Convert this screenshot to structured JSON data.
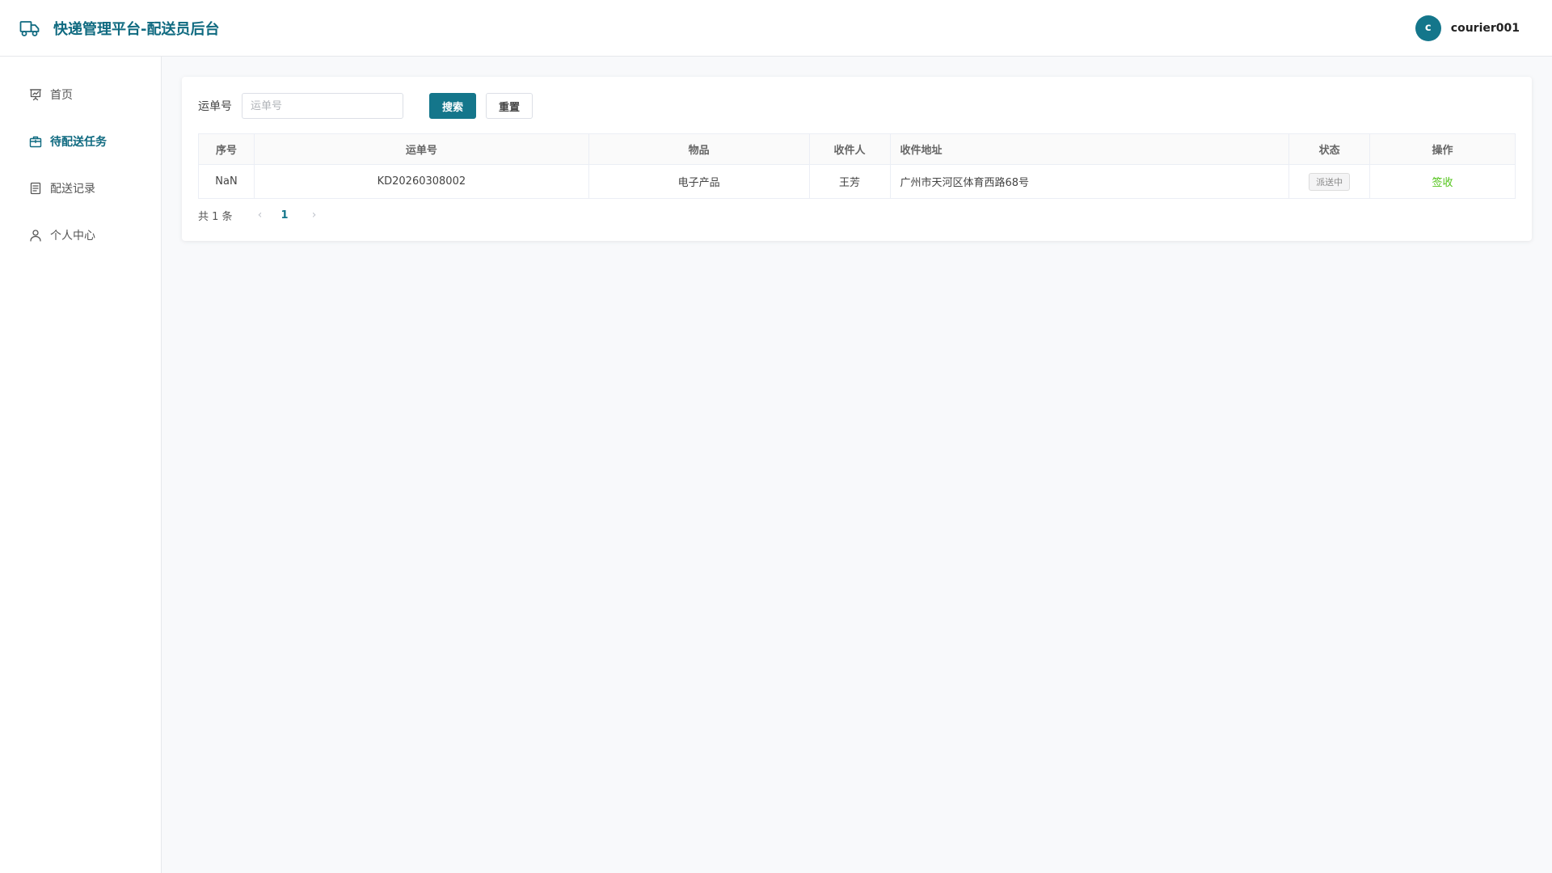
{
  "header": {
    "title": "快递管理平台-配送员后台",
    "brand_icon": "truck-icon",
    "avatar_letter": "c",
    "username": "courier001"
  },
  "sidebar": {
    "items": [
      {
        "label": "首页",
        "icon": "presentation-chart-icon",
        "active": false
      },
      {
        "label": "待配送任务",
        "icon": "package-icon",
        "active": true
      },
      {
        "label": "配送记录",
        "icon": "document-icon",
        "active": false
      },
      {
        "label": "个人中心",
        "icon": "user-icon",
        "active": false
      }
    ]
  },
  "search": {
    "label": "运单号",
    "placeholder": "运单号",
    "value": "",
    "search_button": "搜索",
    "reset_button": "重置"
  },
  "table": {
    "columns": [
      "序号",
      "运单号",
      "物品",
      "收件人",
      "收件地址",
      "状态",
      "操作"
    ],
    "rows": [
      {
        "index": "NaN",
        "waybill": "KD20260308002",
        "item": "电子产品",
        "recipient": "王芳",
        "address": "广州市天河区体育西路68号",
        "status": "派送中",
        "action": "签收"
      }
    ]
  },
  "pagination": {
    "total_text": "共 1 条",
    "current_page": "1"
  },
  "colors": {
    "primary": "#14768b",
    "brand_text": "#0f6a80",
    "action_green": "#52c41a"
  }
}
